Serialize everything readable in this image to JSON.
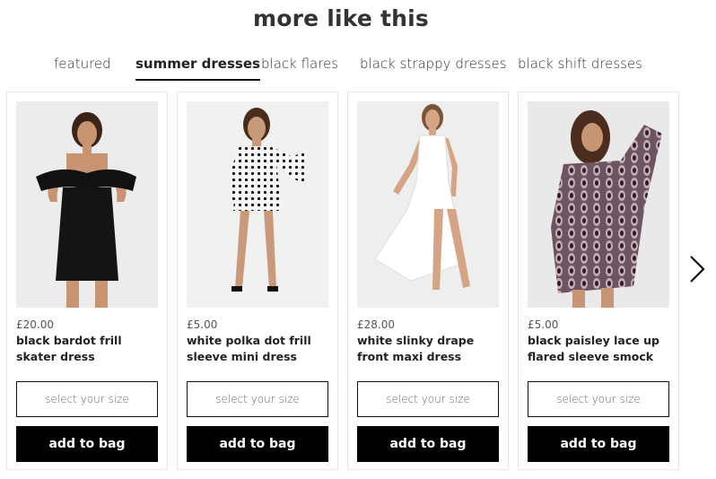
{
  "section": {
    "title": "more like this"
  },
  "tabs": [
    {
      "label": "featured",
      "active": false
    },
    {
      "label": "summer dresses",
      "active": true
    },
    {
      "label": "black flares",
      "active": false
    },
    {
      "label": "black strappy dresses",
      "active": false
    },
    {
      "label": "black shift dresses",
      "active": false
    }
  ],
  "products": [
    {
      "price": "£20.00",
      "name": "black bardot frill skater dress",
      "size_placeholder": "select your size",
      "add_label": "add to bag"
    },
    {
      "price": "£5.00",
      "name": "white polka dot frill sleeve mini dress",
      "size_placeholder": "select your size",
      "add_label": "add to bag"
    },
    {
      "price": "£28.00",
      "name": "white slinky drape front maxi dress",
      "size_placeholder": "select your size",
      "add_label": "add to bag"
    },
    {
      "price": "£5.00",
      "name": "black paisley lace up flared sleeve smock",
      "size_placeholder": "select your size",
      "add_label": "add to bag"
    }
  ],
  "carousel": {
    "next_icon": "chevron-right-icon"
  },
  "colors": {
    "button_bg": "#000000",
    "button_text": "#ffffff",
    "border": "#e6e6e6"
  }
}
